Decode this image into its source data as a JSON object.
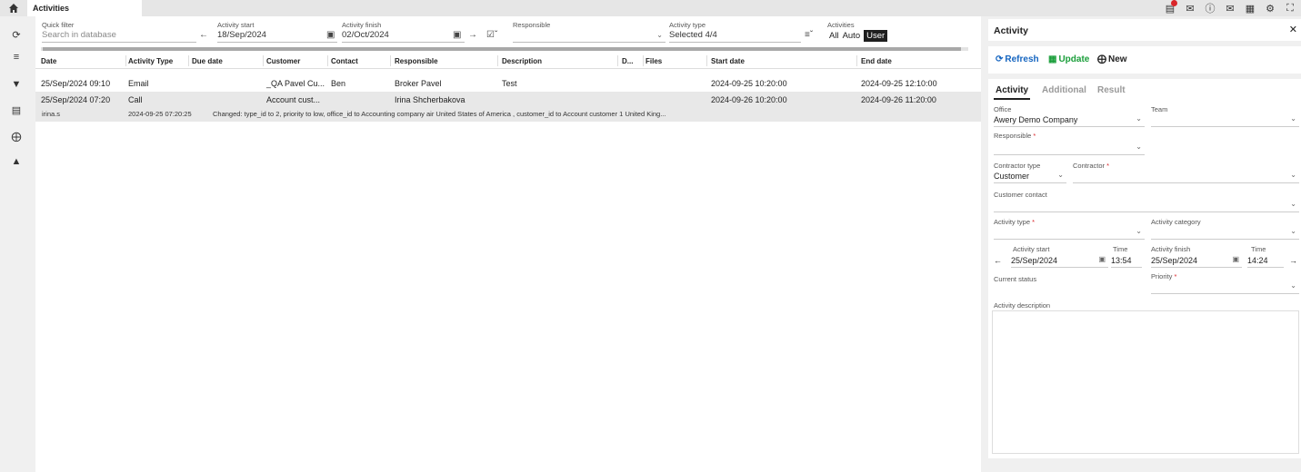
{
  "tab": {
    "label": "Activities"
  },
  "filters": {
    "quick_filter_label": "Quick filter",
    "quick_filter_placeholder": "Search in database",
    "activity_start_label": "Activity start",
    "activity_start_value": "18/Sep/2024",
    "activity_finish_label": "Activity finish",
    "activity_finish_value": "02/Oct/2024",
    "responsible_label": "Responsible",
    "activity_type_label": "Activity type",
    "activity_type_value": "Selected 4/4",
    "activities_label": "Activities",
    "activities_options": [
      "All",
      "Auto",
      "User"
    ]
  },
  "table": {
    "headers": [
      "Date",
      "Activity Type",
      "Due date",
      "Customer",
      "Contact",
      "Responsible",
      "Description",
      "D...",
      "Files",
      "Start date",
      "End date"
    ],
    "rows": [
      {
        "date": "25/Sep/2024 09:10",
        "type": "Email",
        "due": "",
        "customer": "_QA Pavel Cu...",
        "contact": "Ben",
        "responsible": "Broker Pavel",
        "description": "Test",
        "start": "2024-09-25 10:20:00",
        "end": "2024-09-25 12:10:00"
      },
      {
        "date": "25/Sep/2024 07:20",
        "type": "Call",
        "due": "",
        "customer": "Account cust...",
        "contact": "",
        "responsible": "Irina Shcherbakova",
        "description": "",
        "start": "2024-09-26 10:20:00",
        "end": "2024-09-26 11:20:00",
        "sub_user": "irina.s",
        "sub_time": "2024-09-25 07:20:25",
        "sub_text": "Changed: type_id to 2, priority to low, office_id to Accounting company air United States of America , customer_id to Account customer 1 United King..."
      }
    ]
  },
  "panel": {
    "title": "Activity",
    "refresh": "Refresh",
    "update": "Update",
    "new": "New",
    "tabs": [
      "Activity",
      "Additional",
      "Result"
    ],
    "office_label": "Office",
    "office_value": "Awery Demo Company",
    "team_label": "Team",
    "responsible_label": "Responsible",
    "contractor_type_label": "Contractor type",
    "contractor_type_value": "Customer",
    "contractor_label": "Contractor",
    "customer_contact_label": "Customer contact",
    "activity_type_label": "Activity type",
    "activity_category_label": "Activity category",
    "activity_start_label": "Activity start",
    "activity_start_value": "25/Sep/2024",
    "time_label": "Time",
    "start_time": "13:54",
    "activity_finish_label": "Activity finish",
    "activity_finish_value": "25/Sep/2024",
    "finish_time": "14:24",
    "current_status_label": "Current status",
    "priority_label": "Priority",
    "description_label": "Activity description",
    "required_mark": "*"
  },
  "icons": {
    "home": "home-icon",
    "refresh": "refresh-icon",
    "filters": "sliders-icon",
    "funnel": "filter-icon",
    "document": "document-icon",
    "add": "plus-circle-icon",
    "eraser": "eraser-icon"
  },
  "colors": {
    "accent_green": "#1a9e3a",
    "accent_blue": "#1565c0",
    "required": "#d9262a"
  }
}
